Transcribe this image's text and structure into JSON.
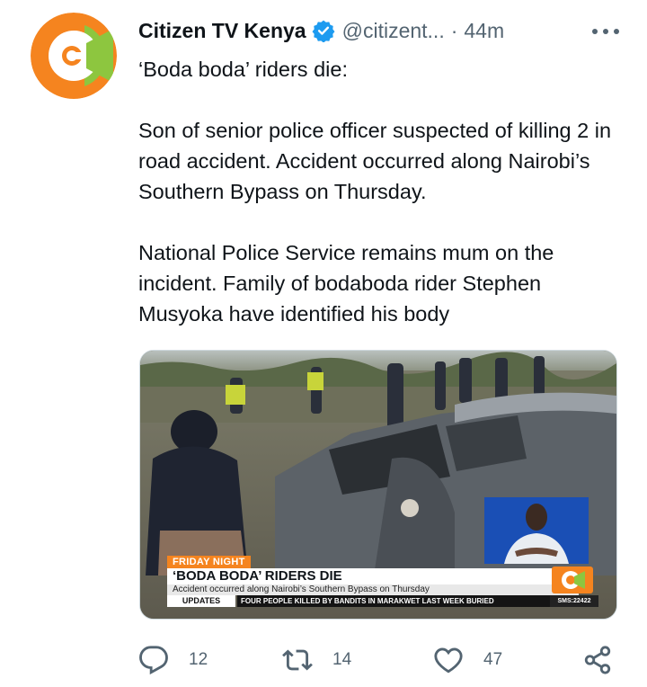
{
  "tweet": {
    "author_name": "Citizen TV Kenya",
    "handle": "@citizent...",
    "separator": "·",
    "time": "44m",
    "paragraphs": [
      "‘Boda boda’ riders die:",
      "Son of senior police officer suspected of killing 2 in road accident. Accident occurred along Nairobi’s Southern Bypass on Thursday.",
      "National Police Service remains mum on the incident. Family of bodaboda rider Stephen Musyoka have identified his body"
    ]
  },
  "media": {
    "program_label": "FRIDAY NIGHT",
    "headline": "‘BODA BODA’ RIDERS DIE",
    "subline": "Accident occurred along Nairobi’s Southern Bypass on Thursday",
    "updates_label": "UPDATES",
    "crawl": "FOUR PEOPLE KILLED BY BANDITS IN MARAKWET LAST WEEK BURIED",
    "sms": "SMS:22422"
  },
  "actions": {
    "reply_count": "12",
    "retweet_count": "14",
    "like_count": "47"
  },
  "colors": {
    "text": "#0f1419",
    "secondary": "#536471",
    "verified": "#1d9bf0",
    "brand_orange": "#f5841f",
    "brand_green": "#8dc63f"
  },
  "icons": [
    "avatar-logo",
    "verified-icon",
    "more-icon",
    "reply-icon",
    "retweet-icon",
    "like-icon",
    "share-icon"
  ]
}
